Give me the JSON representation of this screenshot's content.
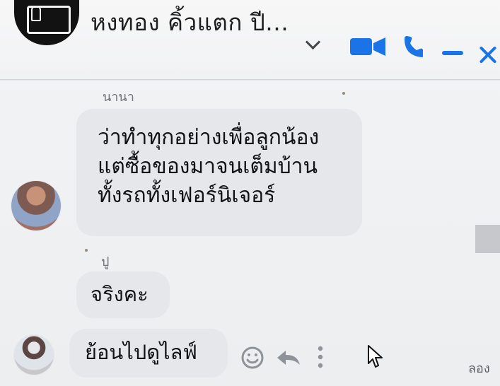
{
  "header": {
    "title": "หงทอง คิ้วแตก ปี...",
    "icons": {
      "group": "group-avatar-icon",
      "dropdown": "chevron-down-icon",
      "video": "video-call-icon",
      "phone": "phone-call-icon",
      "minimize": "minimize-icon",
      "close": "close-icon"
    },
    "colors": {
      "accent": "#1a74e8",
      "title": "#1d1e20"
    }
  },
  "messages": [
    {
      "sender": "นานา",
      "lines": [
        "ว่าทำทุกอย่างเพื่อลูกน้อง",
        "แต่ซื้อของมาจนเต็มบ้าน",
        "ทั้งรถทั้งเฟอร์นิเจอร์"
      ]
    },
    {
      "sender": "ปู",
      "text": "จริงคะ"
    },
    {
      "text": "ย้อนไปดูไลฟ์"
    }
  ],
  "message_actions": {
    "react_icon": "smiley-icon",
    "reply_icon": "reply-icon",
    "more_icon": "more-options-icon",
    "cursor_icon": "cursor-icon"
  },
  "side_panel": {
    "partial_text": "ลอง"
  },
  "colors": {
    "bubble": "#e6e7ea",
    "window_bg": "#eceef0"
  }
}
